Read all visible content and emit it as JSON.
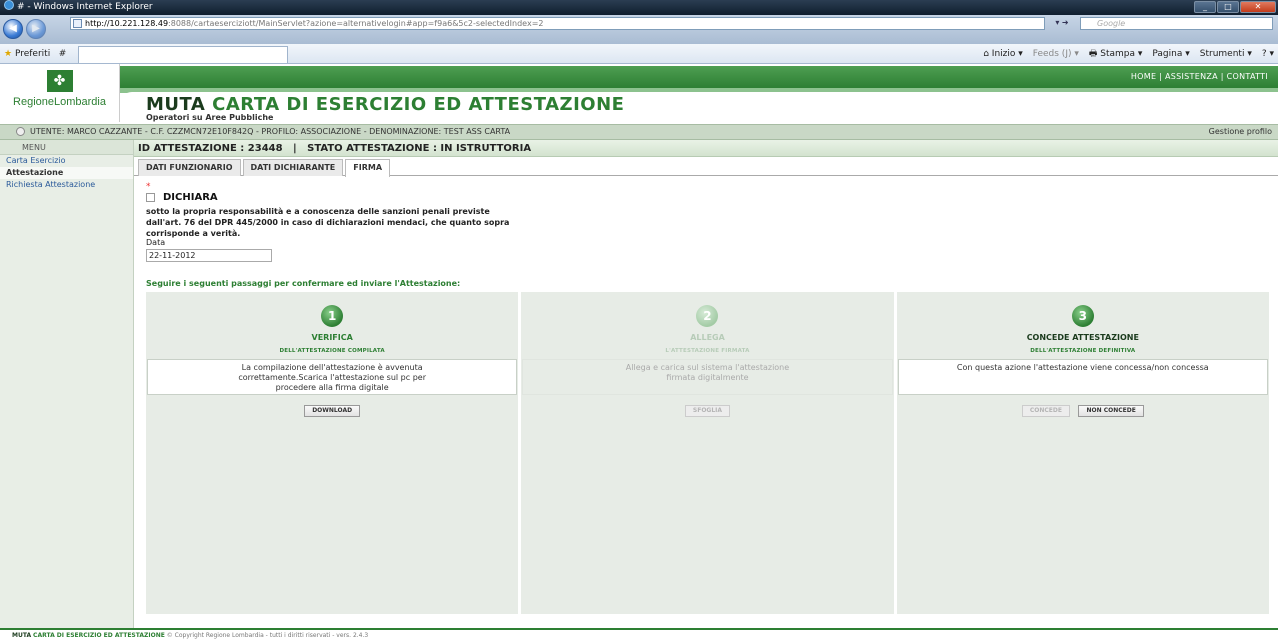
{
  "browser": {
    "title": "# - Windows Internet Explorer",
    "url_host": "http://10.221.128.49",
    "url_rest": ":8088/cartaeserciziott/MainServlet?azione=alternativelogin#app=f9a6&5c2-selectedIndex=2",
    "search_placeholder": "Google",
    "favorites_label": "Preferiti",
    "tab_label": "#",
    "cmd_home": "Inizio",
    "cmd_feeds": "Feeds (J)",
    "cmd_print": "Stampa",
    "cmd_page": "Pagina",
    "cmd_tools": "Strumenti"
  },
  "header": {
    "logo_text": "RegioneLombardia",
    "links": "HOME | ASSISTENZA | CONTATTI",
    "title_muta": "MUTA",
    "title_rest": "CARTA DI ESERCIZIO ED ATTESTAZIONE",
    "subtitle": "Operatori su Aree Pubbliche"
  },
  "user_bar": {
    "info": "UTENTE: MARCO CAZZANTE - C.F. CZZMCN72E10F842Q - PROFILO: ASSOCIAZIONE - DENOMINAZIONE: TEST ASS CARTA",
    "profile_link": "Gestione profilo"
  },
  "sidebar": {
    "menu_label": "MENU",
    "items": [
      {
        "label": "Carta Esercizio"
      },
      {
        "label": "Attestazione"
      },
      {
        "label": "Richiesta Attestazione"
      }
    ]
  },
  "main": {
    "id_line": "ID ATTESTAZIONE : 23448   |   STATO ATTESTAZIONE : IN ISTRUTTORIA",
    "tabs": [
      {
        "label": "DATI FUNZIONARIO"
      },
      {
        "label": "DATI DICHIARANTE"
      },
      {
        "label": "FIRMA"
      }
    ],
    "required_mark": "*",
    "dichiara_label": "DICHIARA",
    "dichiara_text": "sotto la propria responsabilità e a conoscenza delle sanzioni penali previste dall'art. 76 del DPR 445/2000 in caso di dichiarazioni mendaci, che quanto sopra corrisponde a verità.",
    "data_label": "Data",
    "data_value": "22-11-2012",
    "steps_heading": "Seguire i seguenti passaggi per confermare ed inviare l'Attestazione:",
    "steps": [
      {
        "number": "1",
        "title": "VERIFICA",
        "subtitle": "DELL'ATTESTAZIONE COMPILATA",
        "text": "La compilazione dell'attestazione è avvenuta correttamente.Scarica l'attestazione sul pc per procedere alla firma digitale",
        "button": "DOWNLOAD"
      },
      {
        "number": "2",
        "title": "ALLEGA",
        "subtitle": "L'ATTESTAZIONE FIRMATA",
        "text": "Allega e carica sul sistema l'attestazione firmata digitalmente",
        "button": "SFOGLIA"
      },
      {
        "number": "3",
        "title": "CONCEDE ATTESTAZIONE",
        "subtitle": "DELL'ATTESTAZIONE DEFINITIVA",
        "text": "Con questa azione l'attestazione viene concessa/non concessa",
        "button_concede": "CONCEDE",
        "button_non_concede": "NON CONCEDE"
      }
    ]
  },
  "footer": {
    "muta": "MUTA",
    "app": "CARTA DI ESERCIZIO ED ATTESTAZIONE",
    "rest": "© Copyright Regione Lombardia - tutti i diritti riservati - vers. 2.4.3"
  },
  "colors": {
    "brand_green": "#2d7f33",
    "step_panel": "#e7ece6"
  }
}
